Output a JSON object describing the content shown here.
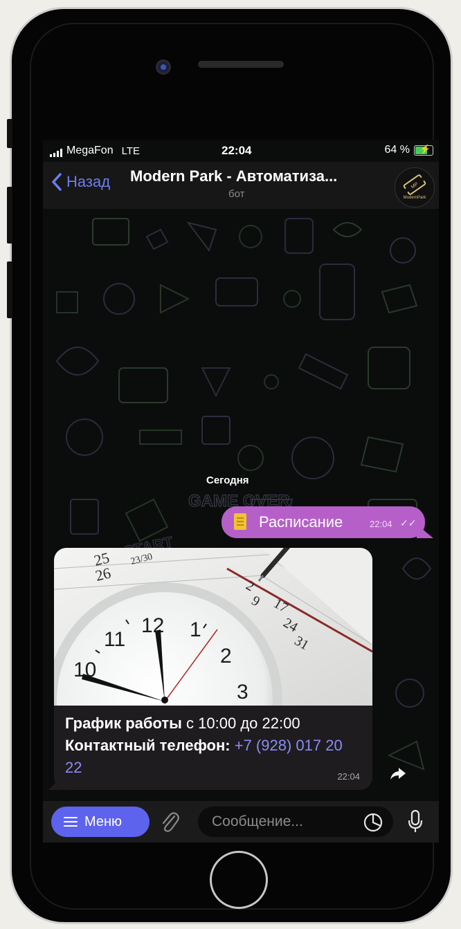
{
  "status_bar": {
    "carrier": "MegaFon",
    "network": "LTE",
    "time": "22:04",
    "battery": "64 %",
    "battery_level": 0.64
  },
  "nav": {
    "back_label": "Назад",
    "title": "Modern Park - Автоматиза...",
    "subtitle": "бот",
    "avatar_label": "ModernPark"
  },
  "chat": {
    "date_separator": "Сегодня",
    "outgoing": {
      "icon": "document-icon",
      "text": "Расписание",
      "time": "22:04",
      "status": "read-double-check"
    },
    "incoming": {
      "photo_subject": "clock-and-calendar",
      "clock_numbers": [
        "10",
        "11",
        "12",
        "1",
        "2",
        "3"
      ],
      "calendar_numbers": [
        "25",
        "23/30",
        "26",
        "2",
        "9",
        "17",
        "24",
        "31"
      ],
      "caption_line1_bold": "График работы",
      "caption_line1_rest": " с 10:00 до 22:00",
      "caption_line2_bold": "Контактный телефон:",
      "caption_phone": " +7 (928) 017 20 22",
      "time": "22:04"
    }
  },
  "input_bar": {
    "menu_label": "Меню",
    "placeholder": "Сообщение..."
  },
  "colors": {
    "accent": "#5d63ec",
    "outgoing_bubble": "#b65fc9",
    "incoming_bubble": "#1e1c1f",
    "link": "#8b8cf5",
    "back_link": "#6c7ff0"
  },
  "background_doodles": [
    "GAME OVER",
    "PRESS START"
  ]
}
